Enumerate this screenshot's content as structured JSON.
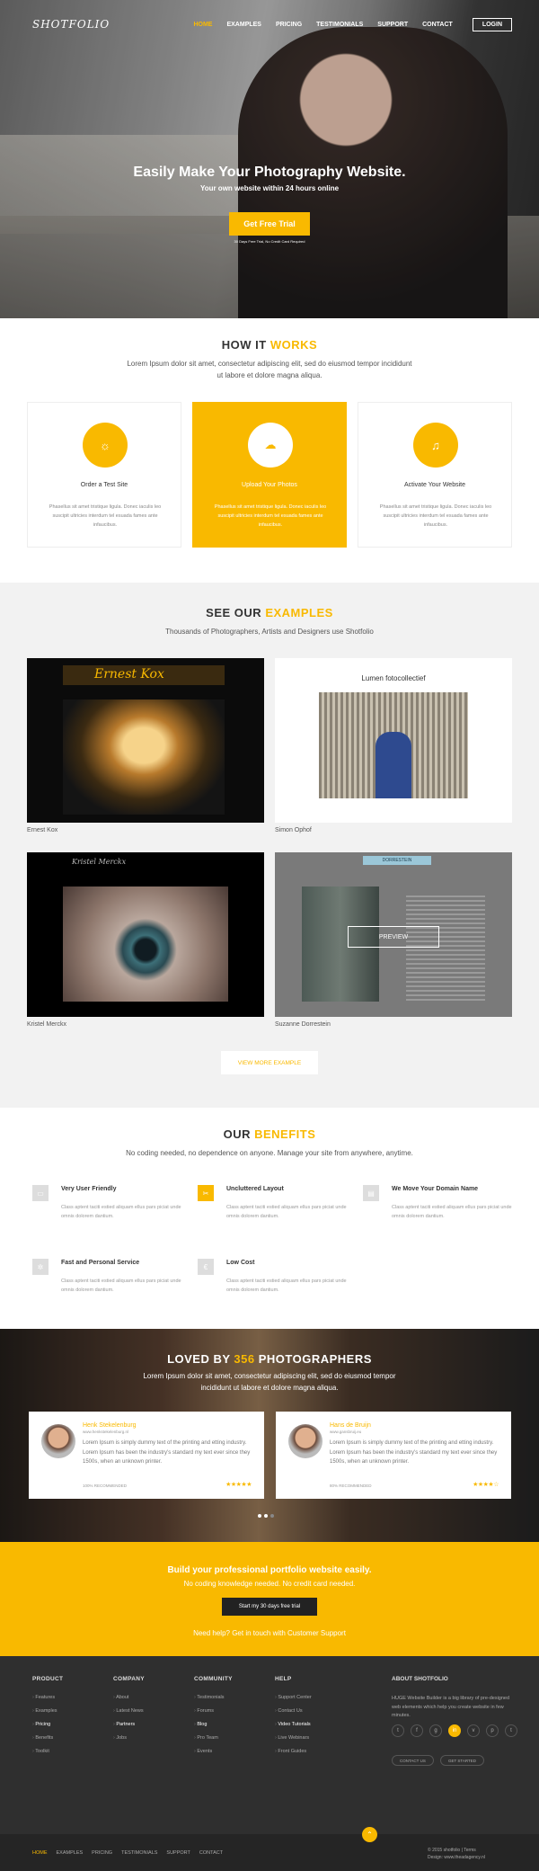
{
  "brand": "SHOTFOLIO",
  "nav": {
    "items": [
      "HOME",
      "EXAMPLES",
      "PRICING",
      "TESTIMONIALS",
      "SUPPORT",
      "CONTACT"
    ],
    "login": "LOGIN",
    "active": "HOME"
  },
  "hero": {
    "title": "Easily Make Your Photography Website.",
    "subtitle": "Your own website within 24 hours online",
    "cta": "Get Free Trial",
    "note": "30 Days Free Trial, No Credit Card Required"
  },
  "how": {
    "title": "HOW IT",
    "title_hl": "WORKS",
    "text": "Lorem Ipsum dolor sit amet, consectetur adipiscing elit, sed do eiusmod tempor incididunt ut labore et dolore magna aliqua.",
    "steps": [
      {
        "title": "Order a Test Site",
        "text": "Phasellus sit amet tristique ligula. Donec iaculis leo suscipit ultricies interdum tel esuada fames ante infaucibus.",
        "icon": "lightbulb-icon"
      },
      {
        "title": "Upload Your Photos",
        "text": "Phasellus sit amet tristique ligula. Donec iaculis leo suscipit ultricies interdum tel esuada fames ante infaucibus.",
        "icon": "cloud-upload-icon"
      },
      {
        "title": "Activate Your Website",
        "text": "Phasellus sit amet tristique ligula. Donec iaculis leo suscipit ultricies interdum tel esuada fames ante infaucibus.",
        "icon": "bell-icon"
      }
    ]
  },
  "examples": {
    "title": "SEE OUR",
    "title_hl": "EXAMPLES",
    "text": "Thousands of Photographers, Artists and Designers use Shotfolio",
    "items": [
      {
        "name": "Ernest Kox",
        "site_title": "Ernest Kox"
      },
      {
        "name": "Simon Ophof",
        "site_title": "Lumen fotocollectief"
      },
      {
        "name": "Kristel Merckx",
        "site_title": "Kristel Merckx"
      },
      {
        "name": "Suzanne Dorrestein",
        "site_title": "DORRESTEIN"
      }
    ],
    "preview": "PREVIEW",
    "more": "VIEW MORE EXAMPLE"
  },
  "benefits": {
    "title": "OUR",
    "title_hl": "BENEFITS",
    "text": "No coding needed, no dependence on anyone. Manage your site from anywhere, anytime.",
    "items": [
      {
        "title": "Very User Friendly",
        "text": "Class aptent taciti estied aliquam ellus pars piciat unde omnis dolorem dantium."
      },
      {
        "title": "Uncluttered Layout",
        "text": "Class aptent taciti estied aliquam ellus pars piciat unde omnis dolorem dantium."
      },
      {
        "title": "We Move Your Domain Name",
        "text": "Class aptent taciti estied aliquam ellus pars piciat unde omnis dolorem dantium."
      },
      {
        "title": "Fast and Personal Service",
        "text": "Class aptent taciti estied aliquam ellus pars piciat unde omnis dolorem dantium."
      },
      {
        "title": "Low Cost",
        "text": "Class aptent taciti estied aliquam ellus pars piciat unde omnis dolorem dantium."
      }
    ]
  },
  "loved": {
    "title_a": "LOVED BY",
    "count": "356",
    "title_b": "PHOTOGRAPHERS",
    "text": "Lorem Ipsum dolor sit amet, consectetur adipiscing elit, sed do eiusmod tempor incididunt ut labore et dolore magna aliqua.",
    "reviews": [
      {
        "name": "Henk Stekelenburg",
        "url": "www.henkstekelenburg.nl",
        "text": "Lorem Ipsum is simply dummy text of the printing and etting industry. Lorem Ipsum has been the industry's standard my text ever since they 1500s, when an unknown printer.",
        "rec": "100% RECOMMENDED",
        "stars": "★★★★★"
      },
      {
        "name": "Hans de Bruijn",
        "url": "www.gansbruij.eu",
        "text": "Lorem Ipsum is simply dummy text of the printing and etting industry. Lorem Ipsum has been the industry's standard my text ever since they 1500s, when an unknown printer.",
        "rec": "80% RECOMMENDED",
        "stars": "★★★★☆"
      }
    ]
  },
  "cta": {
    "title": "Build your professional portfolio website easily.",
    "sub": "No coding knowledge needed. No credit card needed.",
    "button": "Start my 30 days free trial",
    "help": "Need help? Get in touch with Customer Support"
  },
  "footer": {
    "cols": [
      {
        "title": "PRODUCT",
        "items": [
          "Features",
          "Examples",
          "Pricing",
          "Benefits",
          "Toolkit"
        ],
        "bold": 2
      },
      {
        "title": "COMPANY",
        "items": [
          "About",
          "Latest News",
          "Partners",
          "Jobs"
        ],
        "bold": 2
      },
      {
        "title": "COMMUNITY",
        "items": [
          "Testimonials",
          "Forums",
          "Blog",
          "Pro Team",
          "Events"
        ],
        "bold": 2
      },
      {
        "title": "HELP",
        "items": [
          "Support Center",
          "Contact Us",
          "Video Tutorials",
          "Live Webinars",
          "Front Guides"
        ],
        "bold": 2
      }
    ],
    "about_title": "ABOUT SHOTFOLIO",
    "about_text": "HUGE Website Builder is a big library of pre-designed web elements which help you create website in few minutes.",
    "social": [
      "t",
      "f",
      "g",
      "in",
      "v",
      "p",
      "t"
    ],
    "contact_btn": "CONTACT US",
    "started_btn": "GET STARTED",
    "bottom_nav": [
      "HOME",
      "EXAMPLES",
      "PRICING",
      "TESTIMONIALS",
      "SUPPORT",
      "CONTACT"
    ],
    "copy": "© 2015 shotfolio | Terms",
    "design": "Design: www.theadagency.nl"
  }
}
